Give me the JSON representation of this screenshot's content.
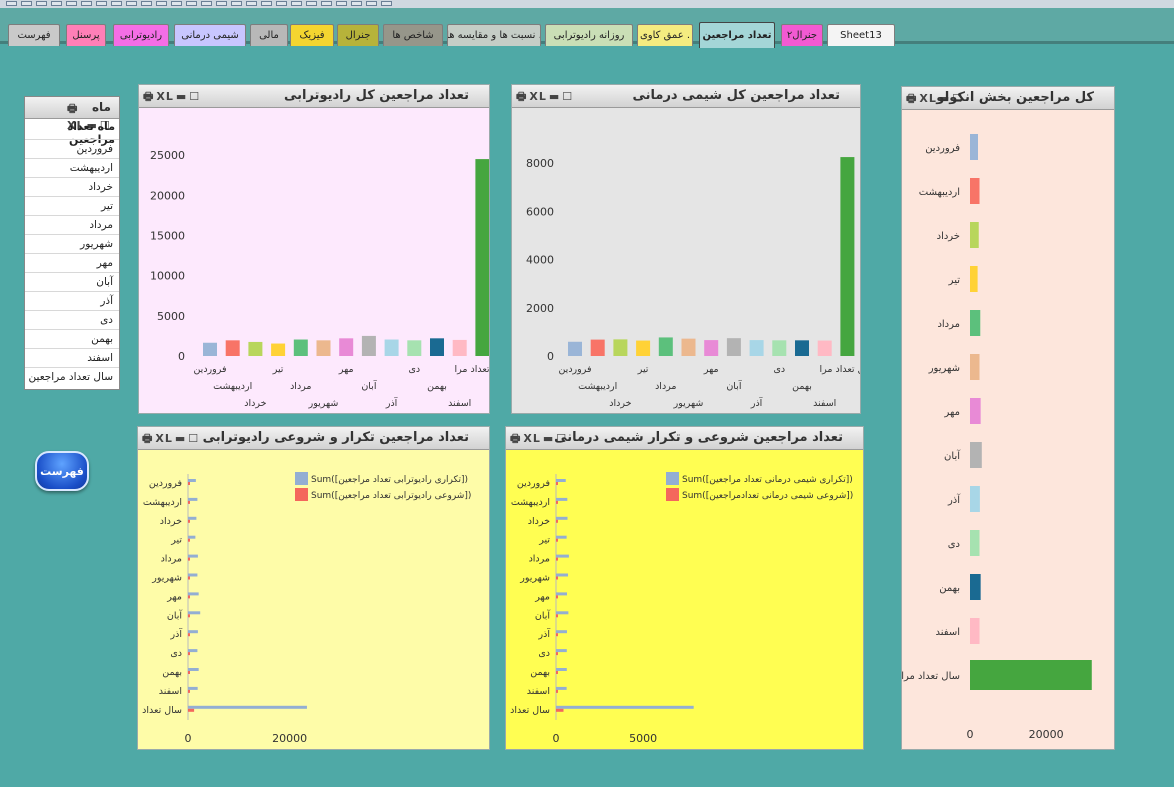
{
  "tabs": [
    {
      "label": "فهرست",
      "color": "#c9c9c9"
    },
    {
      "label": "پرسنل",
      "color": "#ff7fb7"
    },
    {
      "label": "رادیوترابی",
      "color": "#f46ee6"
    },
    {
      "label": "شیمی درمانی",
      "color": "#c8c6ff"
    },
    {
      "label": "مالی",
      "color": "#b8b8b8"
    },
    {
      "label": "فیزیک",
      "color": "#f4d530"
    },
    {
      "label": "جنرال",
      "color": "#b7b33a"
    },
    {
      "label": "شاخص ها",
      "color": "#96968a"
    },
    {
      "label": "نسبت ها و مقایسه ها .",
      "color": "#c5cdc6"
    },
    {
      "label": "روزانه رادیوترابی",
      "color": "#cadfb6"
    },
    {
      "label": "عمق کاوی .",
      "color": "#f4ec80"
    },
    {
      "label": "تعداد مراجعین",
      "color": "#a4d6d7",
      "active": true
    },
    {
      "label": "جنرال۲",
      "color": "#f25ad2"
    },
    {
      "label": "Sheet13",
      "color": "#f4f4f4"
    }
  ],
  "controls": {
    "print": "🖶",
    "xl": "XL",
    "min": "▬",
    "max": "☐"
  },
  "month_list": {
    "title": "ماه",
    "header": "ماه تعداد مراجعین",
    "items": [
      "فروردین",
      "اردیبهشت",
      "خرداد",
      "تیر",
      "مرداد",
      "شهریور",
      "مهر",
      "آبان",
      "آذر",
      "دی",
      "بهمن",
      "اسفند",
      "سال تعداد مراجعین"
    ]
  },
  "home_button": "فهرست",
  "colors": {
    "months": [
      "#9ab5d7",
      "#f87467",
      "#b8d65c",
      "#ffd236",
      "#5cc07c",
      "#ecb88e",
      "#e88ad6",
      "#b3b3b3",
      "#a8d6e7",
      "#a6e2b0",
      "#1a6a92",
      "#ffb9c4",
      "#45a63f"
    ],
    "blue": "#93aed3",
    "red": "#f4675c"
  },
  "chart_data": [
    {
      "id": "radio_total",
      "type": "bar",
      "title": "تعداد مراجعین کل رادیوترابی",
      "categories": [
        "فروردین",
        "اردیبهشت",
        "خرداد",
        "تیر",
        "مرداد",
        "شهریور",
        "مهر",
        "آبان",
        "آذر",
        "دی",
        "بهمن",
        "اسفند",
        "سال تعداد مرا"
      ],
      "values": [
        1650,
        1950,
        1750,
        1550,
        2050,
        1950,
        2200,
        2500,
        2050,
        1950,
        2200,
        2000,
        24500
      ],
      "yticks": [
        0,
        5000,
        10000,
        15000,
        20000,
        25000
      ],
      "ylim": [
        0,
        27000
      ],
      "background": "#fde9fd"
    },
    {
      "id": "chemo_total",
      "type": "bar",
      "title": "تعداد مراجعین کل شیمی درمانی",
      "categories": [
        "فروردین",
        "اردیبهشت",
        "خرداد",
        "تیر",
        "مرداد",
        "شهریور",
        "مهر",
        "آبان",
        "آذر",
        "دی",
        "بهمن",
        "اسفند",
        "سال تعداد مرا"
      ],
      "values": [
        590,
        680,
        690,
        640,
        770,
        720,
        660,
        740,
        660,
        650,
        650,
        640,
        8250
      ],
      "yticks": [
        0,
        2000,
        4000,
        6000,
        8000
      ],
      "ylim": [
        0,
        9000
      ],
      "background": "#e5e5e5"
    },
    {
      "id": "onco_total",
      "type": "bar",
      "orientation": "horizontal",
      "title": "کل مراجعین بخش انکولو",
      "categories": [
        "فروردین",
        "اردیبهشت",
        "خرداد",
        "تیر",
        "مرداد",
        "شهریور",
        "مهر",
        "آبان",
        "آذر",
        "دی",
        "بهمن",
        "اسفند",
        "سال تعداد مراج"
      ],
      "values": [
        2100,
        2500,
        2300,
        2000,
        2700,
        2500,
        2800,
        3100,
        2600,
        2500,
        2800,
        2500,
        32000
      ],
      "xticks": [
        0,
        20000
      ],
      "xlim": [
        0,
        36000
      ],
      "background": "#fde6dc"
    },
    {
      "id": "radio_repeat_new",
      "type": "bar",
      "orientation": "horizontal",
      "title": "تعداد مراجعین تکرار و شروعی رادیوترابی",
      "categories": [
        "فروردین",
        "اردیبهشت",
        "خرداد",
        "تیر",
        "مرداد",
        "شهریور",
        "مهر",
        "آبان",
        "آذر",
        "دی",
        "بهمن",
        "اسفند",
        "سال تعداد"
      ],
      "series": [
        {
          "name": "Sum([تکراری رادیوترابی تعداد مراجعین])",
          "values": [
            1550,
            1850,
            1650,
            1450,
            1950,
            1850,
            2100,
            2400,
            1950,
            1850,
            2100,
            1900,
            23400
          ]
        },
        {
          "name": "Sum([شروعی رادیوترابی تعداد مراجعین])",
          "values": [
            90,
            100,
            95,
            85,
            110,
            100,
            105,
            115,
            100,
            95,
            105,
            100,
            1200
          ]
        }
      ],
      "xticks": [
        0,
        20000
      ],
      "xlim": [
        0,
        60000
      ],
      "background": "#fefca8"
    },
    {
      "id": "chemo_new_repeat",
      "type": "bar",
      "orientation": "horizontal",
      "title": "تعداد مراجعین شروعی و تکرار شیمی درمانی",
      "categories": [
        "فروردین",
        "اردیبهشت",
        "خرداد",
        "تیر",
        "مرداد",
        "شهریور",
        "مهر",
        "آبان",
        "آذر",
        "دی",
        "بهمن",
        "اسفند",
        "سال تعداد"
      ],
      "series": [
        {
          "name": "Sum([تکراری شیمی درمانی تعداد مراجعین])",
          "values": [
            560,
            650,
            660,
            610,
            740,
            690,
            630,
            710,
            630,
            620,
            620,
            610,
            7900
          ]
        },
        {
          "name": "Sum([شروعی شیمی درمانی تعدادمراجعین])",
          "values": [
            35,
            40,
            38,
            35,
            42,
            40,
            38,
            42,
            38,
            37,
            37,
            36,
            430
          ]
        }
      ],
      "xticks": [
        0,
        5000
      ],
      "xlim": [
        0,
        17500
      ],
      "background": "#fffe52"
    }
  ]
}
